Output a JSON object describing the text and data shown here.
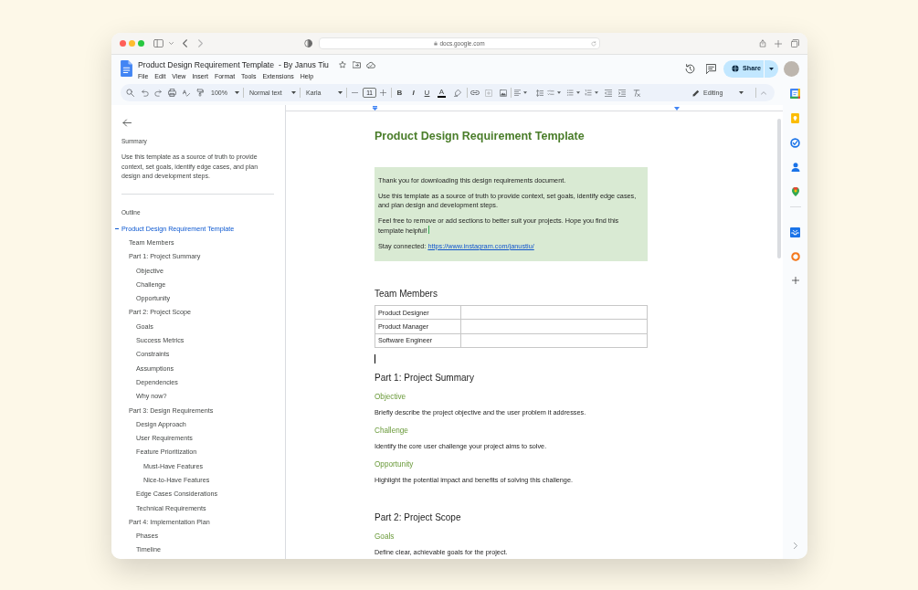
{
  "browser": {
    "url": "docs.google.com"
  },
  "doc_header": {
    "title": "Product Design Requirement Template  - By Janus Tiu",
    "menu": [
      "File",
      "Edit",
      "View",
      "Insert",
      "Format",
      "Tools",
      "Extensions",
      "Help"
    ],
    "share_button": "Share"
  },
  "toolbar": {
    "zoom": "100%",
    "paragraph_style": "Normal text",
    "font": "Karla",
    "font_size": "11",
    "format_buttons": [
      {
        "kind": "bold",
        "label": "B"
      },
      {
        "kind": "italic",
        "label": "I"
      },
      {
        "kind": "underline",
        "label": "U"
      },
      {
        "kind": "text_color",
        "label": "A"
      }
    ],
    "mode": "Editing"
  },
  "sidebar": {
    "summary_heading": "Summary",
    "summary": "Use this template as a source of truth to provide context, set goals, identify edge cases, and plan design and development steps.",
    "outline_heading": "Outline",
    "outline": [
      {
        "label": "Product Design Requirement Template",
        "selected": true,
        "children": [
          {
            "label": "Team Members",
            "selected": false
          },
          {
            "label": "Part 1: Project Summary",
            "selected": false,
            "children": [
              {
                "label": "Objective",
                "selected": false
              },
              {
                "label": "Challenge",
                "selected": false
              },
              {
                "label": "Opportunity",
                "selected": false
              }
            ]
          },
          {
            "label": "Part 2: Project Scope",
            "selected": false,
            "children": [
              {
                "label": "Goals",
                "selected": false
              },
              {
                "label": "Success Metrics",
                "selected": false
              },
              {
                "label": "Constraints",
                "selected": false
              },
              {
                "label": "Assumptions",
                "selected": false
              },
              {
                "label": "Dependencies",
                "selected": false
              },
              {
                "label": "Why now?",
                "selected": false
              }
            ]
          },
          {
            "label": "Part 3: Design Requirements",
            "selected": false,
            "children": [
              {
                "label": "Design Approach",
                "selected": false
              },
              {
                "label": "User Requirements",
                "selected": false
              },
              {
                "label": "Feature Prioritization",
                "selected": false,
                "children": [
                  {
                    "label": "Must-Have Features",
                    "selected": false
                  },
                  {
                    "label": "Nice-to-Have Features",
                    "selected": false
                  }
                ]
              },
              {
                "label": "Edge Cases Considerations",
                "selected": false
              },
              {
                "label": "Technical Requirements",
                "selected": false
              }
            ]
          },
          {
            "label": "Part 4: Implementation Plan",
            "selected": false,
            "children": [
              {
                "label": "Phases",
                "selected": false
              },
              {
                "label": "Timeline",
                "selected": false
              }
            ]
          }
        ]
      }
    ]
  },
  "document": {
    "blocks": [
      {
        "kind": "title",
        "text": "Product Design Requirement Template"
      },
      {
        "kind": "callout",
        "paragraphs": [
          {
            "text": "Thank you for downloading this design requirements document.",
            "collaborator_cursor": false
          },
          {
            "text": "Use this template as a source of truth to provide context, set goals, identify edge cases, and plan design and development steps.",
            "collaborator_cursor": false
          },
          {
            "text": "Feel free to remove or add sections to better suit your projects. Hope you find this template helpful!",
            "collaborator_cursor": true
          },
          {
            "text": "Stay connected:",
            "link": "https://www.instagram.com/janustiu/",
            "collaborator_cursor": false
          }
        ]
      },
      {
        "kind": "heading",
        "text": "Team Members"
      },
      {
        "kind": "table",
        "rows": [
          {
            "column_1": "Product Designer"
          },
          {
            "column_1": "Product Manager"
          },
          {
            "column_1": "Software Engineer"
          }
        ]
      },
      {
        "kind": "caret"
      },
      {
        "kind": "heading",
        "text": "Part 1: Project Summary"
      },
      {
        "kind": "subheading",
        "text": "Objective"
      },
      {
        "kind": "paragraph",
        "text": "Briefly describe the project objective and the user problem it addresses."
      },
      {
        "kind": "subheading",
        "text": "Challenge"
      },
      {
        "kind": "paragraph",
        "text": "Identify the core user challenge your project aims to solve."
      },
      {
        "kind": "subheading",
        "text": "Opportunity"
      },
      {
        "kind": "paragraph",
        "text": "Highlight the potential impact and benefits of solving this challenge."
      },
      {
        "kind": "heading",
        "text": "Part 2: Project Scope"
      },
      {
        "kind": "subheading",
        "text": "Goals"
      },
      {
        "kind": "paragraph",
        "text": "Define clear, achievable goals for the project."
      }
    ]
  }
}
